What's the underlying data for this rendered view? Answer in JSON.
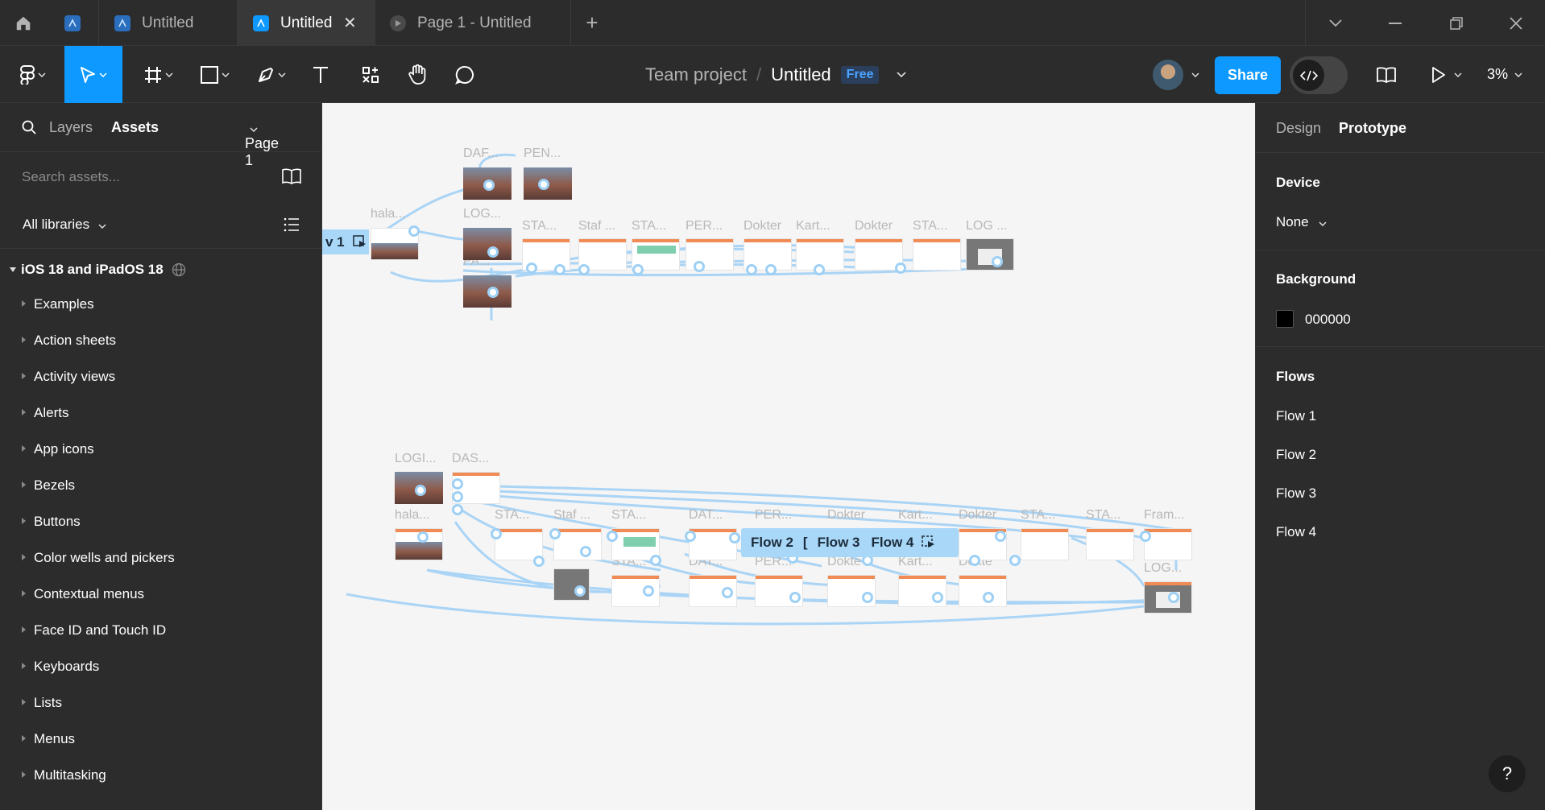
{
  "tabs": [
    {
      "label": "",
      "kind": "home"
    },
    {
      "label": "",
      "kind": "file-icon-only"
    },
    {
      "label": "Untitled",
      "active": false
    },
    {
      "label": "Untitled",
      "active": true
    },
    {
      "label": "Page 1 - Untitled",
      "active": false
    }
  ],
  "toolbar": {
    "breadcrumb_team": "Team project",
    "breadcrumb_sep": "/",
    "file_name": "Untitled",
    "plan_badge": "Free",
    "share_label": "Share",
    "zoom": "3%"
  },
  "left_panel": {
    "tab_layers": "Layers",
    "tab_assets": "Assets",
    "page_select": "Page 1",
    "search_placeholder": "Search assets...",
    "libraries_select": "All libraries",
    "group_title": "iOS 18 and iPadOS 18",
    "items": [
      "Examples",
      "Action sheets",
      "Activity views",
      "Alerts",
      "App icons",
      "Bezels",
      "Buttons",
      "Color wells and pickers",
      "Contextual menus",
      "Face ID and Touch ID",
      "Keyboards",
      "Lists",
      "Menus",
      "Multitasking"
    ]
  },
  "canvas": {
    "labels_top": [
      "DAF...",
      "PEN...",
      "hala...",
      "LOG...",
      "STA...",
      "Staf ...",
      "STA...",
      "PER...",
      "Dokter",
      "Kart...",
      "Dokter",
      "STA...",
      "LOG ...",
      "PA..."
    ],
    "labels_bottom": [
      "LOGI...",
      "DAS...",
      "hala...",
      "STA...",
      "Staf ...",
      "STA...",
      "DAT...",
      "PER...",
      "Dokter",
      "Kart...",
      "Dokter",
      "STA...",
      "STA...",
      "Fram...",
      "STA...",
      "STA...",
      "DAT...",
      "PER...",
      "Dokte",
      "Kart...",
      "Dokte",
      "LOG..."
    ],
    "flow1_chip": "v 1",
    "flows_bar": [
      "Flow 2",
      "[",
      "Flow 3",
      "Flow 4"
    ]
  },
  "right_panel": {
    "tab_design": "Design",
    "tab_prototype": "Prototype",
    "device_title": "Device",
    "device_value": "None",
    "background_title": "Background",
    "background_hex": "000000",
    "flows_title": "Flows",
    "flows": [
      "Flow 1",
      "Flow 2",
      "Flow 3",
      "Flow 4"
    ]
  },
  "help_label": "?",
  "colors": {
    "accent": "#0d99ff",
    "panel": "#2c2c2c",
    "canvas": "#f5f5f5",
    "connector": "#9ed0f5"
  }
}
